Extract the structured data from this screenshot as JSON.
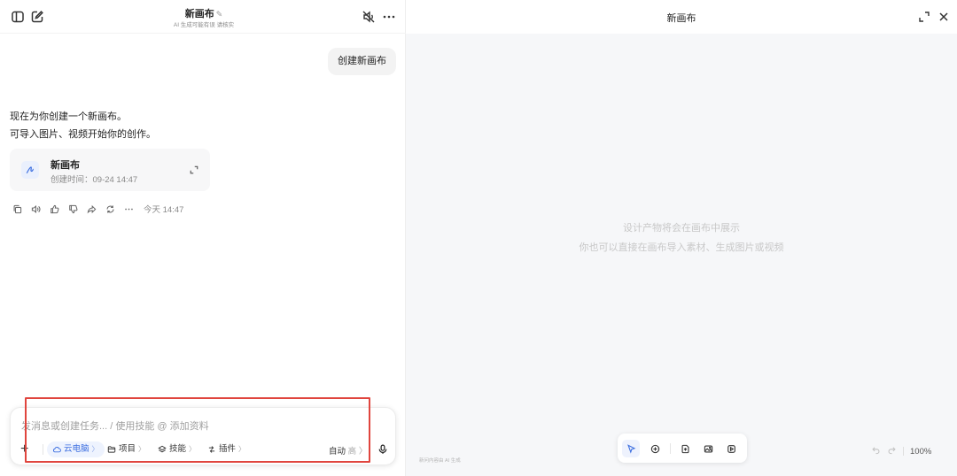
{
  "left_header": {
    "title": "新画布",
    "subtitle": "AI 生成可能有误 请核实"
  },
  "conversation": {
    "user_message": "创建新画布",
    "ai_line1": "现在为你创建一个新画布。",
    "ai_line2": "可导入图片、视频开始你的创作。",
    "card_title": "新画布",
    "card_time": "创建时间：09-24 14:47",
    "timestamp": "今天 14:47"
  },
  "composer": {
    "placeholder": "发消息或创建任务... / 使用技能 @ 添加资料",
    "plus": "+",
    "chip_cloud": "云电脑",
    "chip_project": "项目",
    "chip_skill": "技能",
    "chip_plugin": "插件",
    "auto_label": "自动",
    "auto_level": "高",
    "chevron": "〉"
  },
  "canvas": {
    "title": "新画布",
    "empty_line1": "设计产物将会在画布中展示",
    "empty_line2": "你也可以直接在画布导入素材、生成图片或视频",
    "footnote": "新问内容由 AI 生成",
    "zoom": "100%"
  },
  "colors": {
    "accent": "#3d6fe0",
    "highlight_box": "#e0453e",
    "canvas_bg": "#f6f7f9"
  }
}
